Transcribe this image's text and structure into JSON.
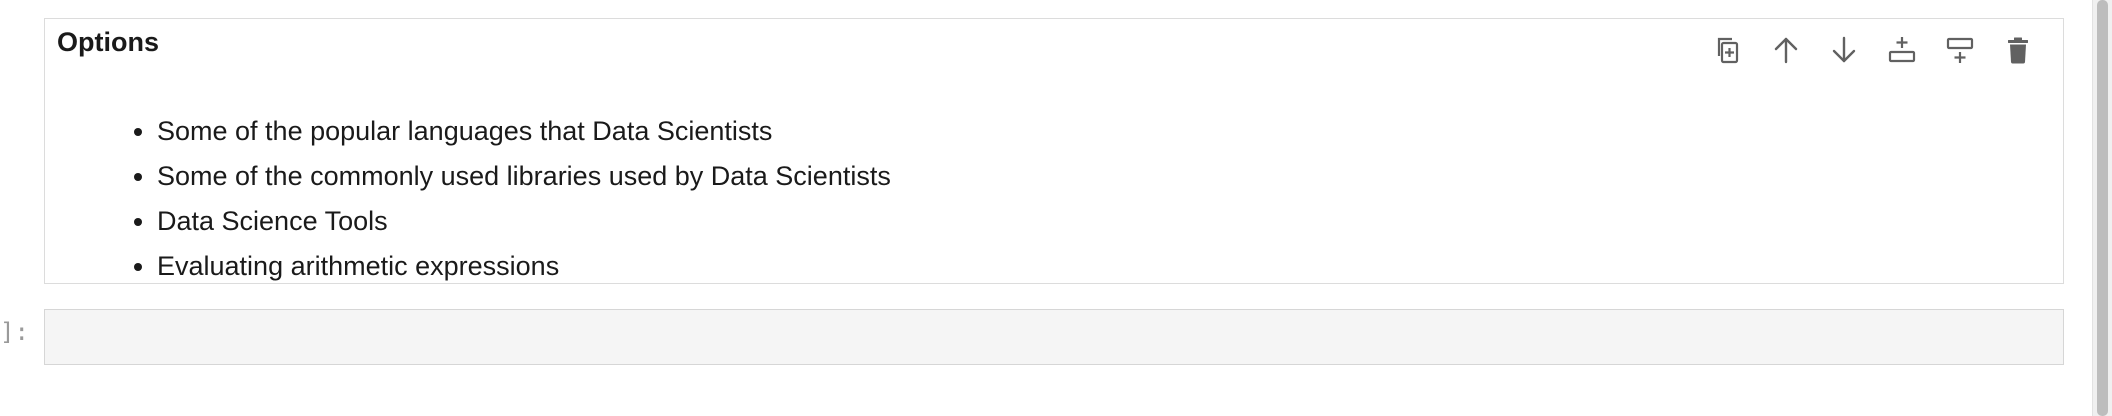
{
  "markdown_cell": {
    "heading": "Options",
    "items": [
      "Some of the popular languages that Data Scientists",
      "Some of the commonly used libraries used by Data Scientists",
      "Data Science Tools",
      "Evaluating arithmetic expressions"
    ],
    "toolbar": [
      {
        "name": "duplicate-cell",
        "icon": "copy-icon"
      },
      {
        "name": "move-cell-up",
        "icon": "arrow-up-icon"
      },
      {
        "name": "move-cell-down",
        "icon": "arrow-down-icon"
      },
      {
        "name": "insert-cell-above",
        "icon": "insert-above-icon"
      },
      {
        "name": "insert-cell-below",
        "icon": "insert-below-icon"
      },
      {
        "name": "delete-cell",
        "icon": "trash-icon"
      }
    ]
  },
  "code_cell": {
    "prompt": "]:",
    "content": ""
  },
  "colors": {
    "icon": "#616161",
    "cell_border": "#dcdcdc",
    "code_cell_background": "#f5f5f5",
    "prompt": "#9a9a9a"
  }
}
